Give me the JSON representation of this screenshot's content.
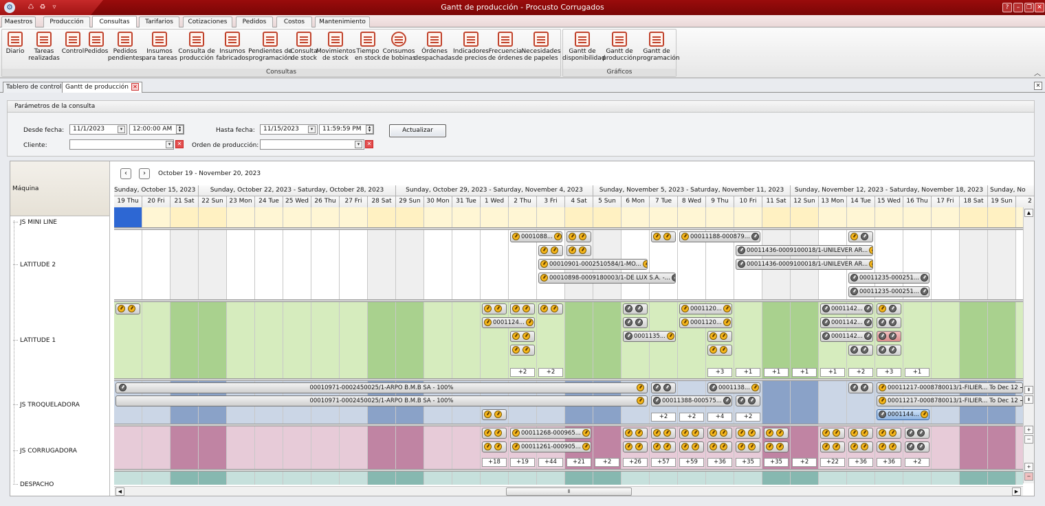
{
  "window": {
    "title": "Gantt de producción - Procusto Corrugados"
  },
  "ribbon_tabs": [
    "Maestros",
    "Producción",
    "Consultas",
    "Tarifarios",
    "Cotizaciones",
    "Pedidos",
    "Costos",
    "Mantenimiento"
  ],
  "active_ribbon_tab": "Consultas",
  "ribbon_groups": {
    "consultas": {
      "label": "Consultas",
      "buttons": [
        [
          "Diario",
          ""
        ],
        [
          "Tareas",
          "realizadas"
        ],
        [
          "Control",
          ""
        ],
        [
          "Pedidos",
          ""
        ],
        [
          "Pedidos",
          "pendientes"
        ],
        [
          "Insumos",
          "para tareas"
        ],
        [
          "Consulta de",
          "producción"
        ],
        [
          "Insumos",
          "fabricados"
        ],
        [
          "Pendientes de",
          "programación"
        ],
        [
          "Consulta",
          "de stock"
        ],
        [
          "Movimientos",
          "de stock"
        ],
        [
          "Tiempo",
          "en stock"
        ],
        [
          "Consumos",
          "de bobinas"
        ],
        [
          "Órdenes",
          "despachadas"
        ],
        [
          "Indicadores",
          "de precios"
        ],
        [
          "Frecuencia",
          "de órdenes"
        ],
        [
          "Necesidades",
          "de papeles"
        ]
      ]
    },
    "graficos": {
      "label": "Gráficos",
      "buttons": [
        [
          "Gantt de",
          "disponibilidad"
        ],
        [
          "Gantt de",
          "producción"
        ],
        [
          "Gantt de",
          "programación"
        ]
      ]
    }
  },
  "doc_tabs": [
    "Tablero de control",
    "Gantt de producción"
  ],
  "params": {
    "header": "Parámetros de la consulta",
    "desde_label": "Desde fecha:",
    "desde_date": "11/1/2023",
    "desde_time": "12:00:00 AM",
    "hasta_label": "Hasta fecha:",
    "hasta_date": "11/15/2023",
    "hasta_time": "11:59:59 PM",
    "cliente_label": "Cliente:",
    "cliente_value": "",
    "orden_label": "Orden de producción:",
    "orden_value": "",
    "update_button": "Actualizar"
  },
  "gantt": {
    "resource_header": "Máquina",
    "range": "October 19 - November 20, 2023",
    "weeks": [
      "Sunday, October 15, 2023 ...",
      "Sunday, October 22, 2023 - Saturday, October 28, 2023",
      "Sunday, October 29, 2023 - Saturday, November 4, 2023",
      "Sunday, November 5, 2023 - Saturday, November 11, 2023",
      "Sunday, November 12, 2023 - Saturday, November 18, 2023",
      "Sunday, No"
    ],
    "days": [
      "19 Thu",
      "20 Fri",
      "21 Sat",
      "22 Sun",
      "23 Mon",
      "24 Tue",
      "25 Wed",
      "26 Thu",
      "27 Fri",
      "28 Sat",
      "29 Sun",
      "30 Mon",
      "31 Tue",
      "1 Wed",
      "2 Thu",
      "3 Fri",
      "4 Sat",
      "5 Sun",
      "6 Mon",
      "7 Tue",
      "8 Wed",
      "9 Thu",
      "10 Fri",
      "11 Sat",
      "12 Sun",
      "13 Mon",
      "14 Tue",
      "15 Wed",
      "16 Thu",
      "17 Fri",
      "18 Sat",
      "19 Sun",
      "2"
    ],
    "resources": [
      "JS MINI LINE",
      "LATITUDE 2",
      "LATITUDE 1",
      "JS TROQUELADORA",
      "JS CORRUGADORA",
      "DESPACHO"
    ],
    "orders": {
      "l2_a": "0001088...",
      "l2_b": "00011188-000879...",
      "l2_c": "00011436-0009100018/1-UNILEVER AR...",
      "l2_d": "00011436-0009100018/1-UNILEVER AR...",
      "l2_e": "00010901-0002510584/1-MO...",
      "l2_f": "00010898-0009180003/1-DE LUX S.A. -...",
      "l2_g": "00011235-000251...",
      "l2_h": "00011235-000251...",
      "l1_a": "0001120...",
      "l1_b": "0001120...",
      "l1_c": "0001124...",
      "l1_d": "0001135...",
      "l1_e": "0001142...",
      "l1_f": "0001142...",
      "l1_g": "0001142...",
      "tr_a": "00010971-0002450025/1-ARPO B.M.B SA - 100%",
      "tr_b": "00010971-0002450025/1-ARPO B.M.B SA - 100%",
      "tr_c": "0001138...",
      "tr_d": "00011388-000575...",
      "tr_e": "00011217-0008780013/1-FILIER...",
      "tr_f": "00011217-0008780013/1-FILIER...",
      "tr_g": "0001144...",
      "tr_to": "To Dec 12",
      "co_a": "00011268-000965...",
      "co_b": "00011261-000905..."
    },
    "more_l1": [
      "+2",
      "+2",
      "+3",
      "+1",
      "+1",
      "+1",
      "+1",
      "+2",
      "+3",
      "+1"
    ],
    "more_tr": [
      "+2",
      "+2",
      "+4",
      "+2"
    ],
    "more_co": [
      "+18",
      "+19",
      "+44",
      "+21",
      "+2",
      "+26",
      "+57",
      "+59",
      "+36",
      "+35",
      "+35",
      "+2",
      "+22",
      "+36",
      "+36",
      "+2"
    ]
  }
}
